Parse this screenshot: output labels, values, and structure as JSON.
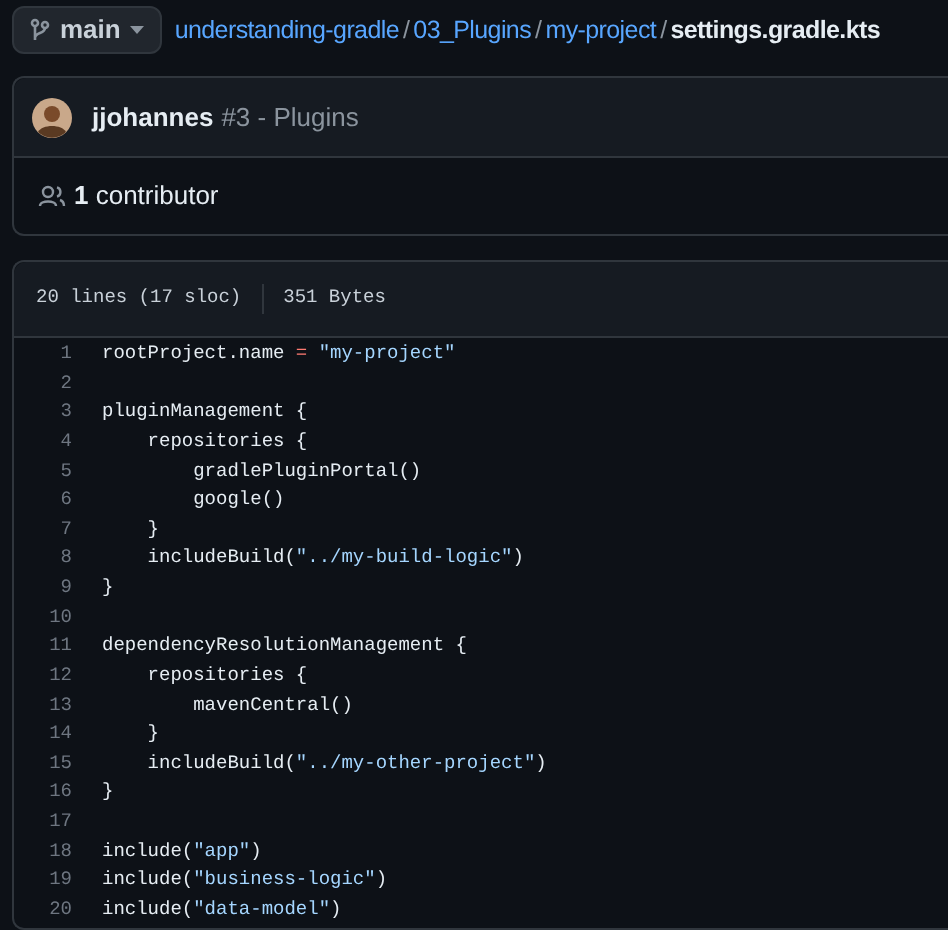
{
  "branch": {
    "label": "main"
  },
  "breadcrumb": [
    {
      "text": "understanding-gradle",
      "kind": "link"
    },
    {
      "text": "/",
      "kind": "separator"
    },
    {
      "text": "03_Plugins",
      "kind": "link"
    },
    {
      "text": "/",
      "kind": "separator"
    },
    {
      "text": "my-project",
      "kind": "link"
    },
    {
      "text": "/",
      "kind": "separator"
    },
    {
      "text": "settings.gradle.kts",
      "kind": "current"
    }
  ],
  "commit": {
    "author": "jjohannes",
    "message": "#3 - Plugins"
  },
  "contributors": {
    "label": "**1** contributor"
  },
  "file_info": {
    "lines": "20 lines (17 sloc)",
    "size": "351 Bytes"
  },
  "code_lines": [
    {
      "number": "1",
      "segments": [
        {
          "kind": "plain",
          "text": "rootProject.name "
        },
        {
          "kind": "operator",
          "text": "= "
        },
        {
          "kind": "string",
          "text": "\"my-project\""
        }
      ]
    },
    {
      "number": "2"
    },
    {
      "number": "3",
      "segments": [
        {
          "kind": "plain",
          "text": "pluginManagement {"
        }
      ]
    },
    {
      "number": "4",
      "segments": [
        {
          "kind": "plain",
          "text": "    repositories {"
        }
      ]
    },
    {
      "number": "5",
      "segments": [
        {
          "kind": "plain",
          "text": "        gradlePluginPortal()"
        }
      ]
    },
    {
      "number": "6",
      "segments": [
        {
          "kind": "plain",
          "text": "        google()"
        }
      ]
    },
    {
      "number": "7",
      "segments": [
        {
          "kind": "plain",
          "text": "    }"
        }
      ]
    },
    {
      "number": "8",
      "segments": [
        {
          "kind": "plain",
          "text": "    includeBuild("
        },
        {
          "kind": "string",
          "text": "\"../my-build-logic\""
        },
        {
          "kind": "plain",
          "text": ")"
        }
      ]
    },
    {
      "number": "9",
      "segments": [
        {
          "kind": "plain",
          "text": "}"
        }
      ]
    },
    {
      "number": "10"
    },
    {
      "number": "11",
      "segments": [
        {
          "kind": "plain",
          "text": "dependencyResolutionManagement {"
        }
      ]
    },
    {
      "number": "12",
      "segments": [
        {
          "kind": "plain",
          "text": "    repositories {"
        }
      ]
    },
    {
      "number": "13",
      "segments": [
        {
          "kind": "plain",
          "text": "        mavenCentral()"
        }
      ]
    },
    {
      "number": "14",
      "segments": [
        {
          "kind": "plain",
          "text": "    }"
        }
      ]
    },
    {
      "number": "15",
      "segments": [
        {
          "kind": "plain",
          "text": "    includeBuild("
        },
        {
          "kind": "string",
          "text": "\"../my-other-project\""
        },
        {
          "kind": "plain",
          "text": ")"
        }
      ]
    },
    {
      "number": "16",
      "segments": [
        {
          "kind": "plain",
          "text": "}"
        }
      ]
    },
    {
      "number": "17"
    },
    {
      "number": "18",
      "segments": [
        {
          "kind": "plain",
          "text": "include("
        },
        {
          "kind": "string",
          "text": "\"app\""
        },
        {
          "kind": "plain",
          "text": ")"
        }
      ]
    },
    {
      "number": "19",
      "segments": [
        {
          "kind": "plain",
          "text": "include("
        },
        {
          "kind": "string",
          "text": "\"business-logic\""
        },
        {
          "kind": "plain",
          "text": ")"
        }
      ]
    },
    {
      "number": "20",
      "segments": [
        {
          "kind": "plain",
          "text": "include("
        },
        {
          "kind": "string",
          "text": "\"data-model\""
        },
        {
          "kind": "plain",
          "text": ")"
        }
      ]
    }
  ]
}
